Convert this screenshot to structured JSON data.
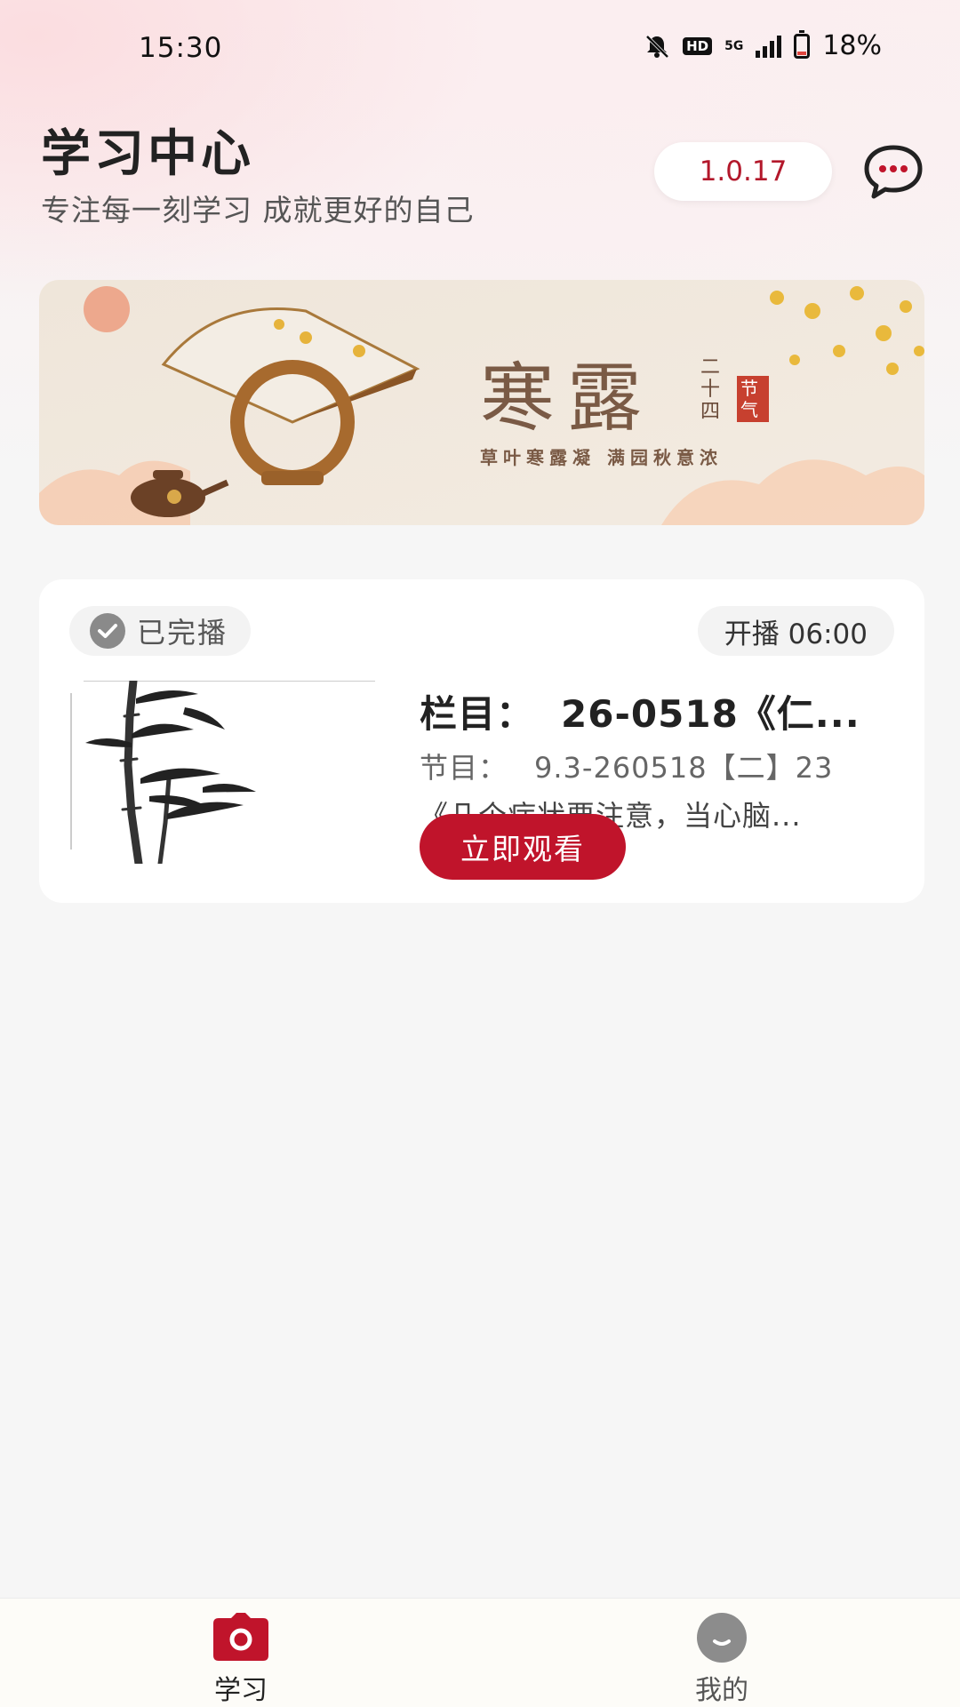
{
  "status_bar": {
    "time": "15:30",
    "hd": "HD",
    "network": "5G",
    "battery": "18%",
    "battery_level": 0.18
  },
  "header": {
    "title": "学习中心",
    "subtitle": "专注每一刻学习 成就更好的自己",
    "version": "1.0.17",
    "chat_icon": "chat-bubble-icon"
  },
  "banner": {
    "big_text": "寒露",
    "side_text": "二十四",
    "seal_text": "节气",
    "tagline": "草叶寒露凝 满园秋意浓"
  },
  "card": {
    "status": "已完播",
    "start_time": "开播 06:00",
    "column_label": "栏目：",
    "column_value": "26-0518《仁...",
    "program_label": "节目：",
    "program_value": "9.3-260518【二】23",
    "description": "《几个症状要注意，当心脑...",
    "watch_label": "立即观看"
  },
  "nav": {
    "items": [
      {
        "label": "学习",
        "icon": "study-camera-icon",
        "active": true,
        "color": "#c0142b"
      },
      {
        "label": "我的",
        "icon": "profile-smile-icon",
        "active": false,
        "color": "#555555"
      }
    ]
  },
  "colors": {
    "accent": "#c0142b",
    "background": "#f6f6f6"
  }
}
